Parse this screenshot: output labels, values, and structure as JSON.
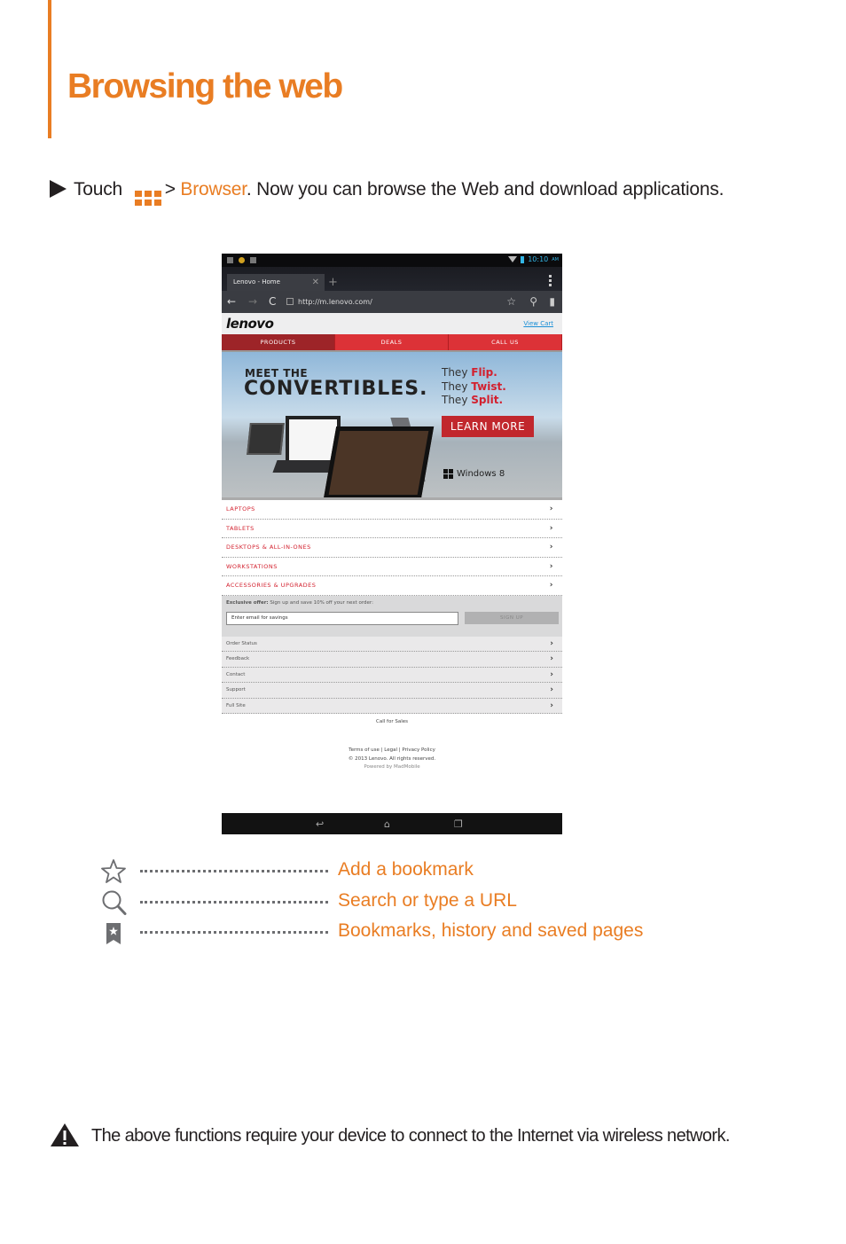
{
  "page": {
    "title": "Browsing the web",
    "accent_color": "#e97d23"
  },
  "instruction": {
    "prefix": "Touch",
    "app_icon": "apps-grid-icon",
    "separator": ">",
    "link": "Browser",
    "suffix": ". Now you can browse the Web and download applications."
  },
  "device": {
    "status_bar": {
      "time": "10:10",
      "ampm": "AM"
    },
    "browser": {
      "tab_title": "Lenovo - Home",
      "new_tab": "+",
      "url": "http://m.lenovo.com/"
    },
    "site": {
      "logo": "lenovo",
      "view_cart": "View Cart",
      "nav": [
        "PRODUCTS",
        "DEALS",
        "CALL US"
      ],
      "hero": {
        "line1": "MEET THE",
        "line2": "CONVERTIBLES.",
        "they1": "They",
        "verb1": "Flip.",
        "they2": "They",
        "verb2": "Twist.",
        "they3": "They",
        "verb3": "Split.",
        "cta": "LEARN MORE",
        "os": "Windows 8"
      },
      "categories": [
        "LAPTOPS",
        "TABLETS",
        "DESKTOPS & ALL-IN-ONES",
        "WORKSTATIONS",
        "ACCESSORIES & UPGRADES"
      ],
      "offer": {
        "bold": "Exclusive offer:",
        "text": " Sign up and save 10% off your next order:",
        "email_placeholder": "Enter email for savings",
        "signup": "SIGN UP"
      },
      "secondary": [
        "Order Status",
        "Feedback",
        "Contact",
        "Support",
        "Full Site"
      ],
      "footer": {
        "call": "Call for Sales",
        "links": [
          "Terms of use",
          "Legal",
          "Privacy Policy"
        ],
        "copyright": "© 2013 Lenovo. All rights reserved.",
        "powered": "Powered by MadMobile"
      }
    }
  },
  "legend": [
    {
      "icon": "star-outline-icon",
      "label": "Add a bookmark"
    },
    {
      "icon": "search-icon",
      "label": "Search or type a URL"
    },
    {
      "icon": "bookmarks-icon",
      "label": "Bookmarks, history and saved pages"
    }
  ],
  "note": {
    "icon": "warning-icon",
    "text": "The above functions require your device to connect to the Internet via wireless network."
  }
}
